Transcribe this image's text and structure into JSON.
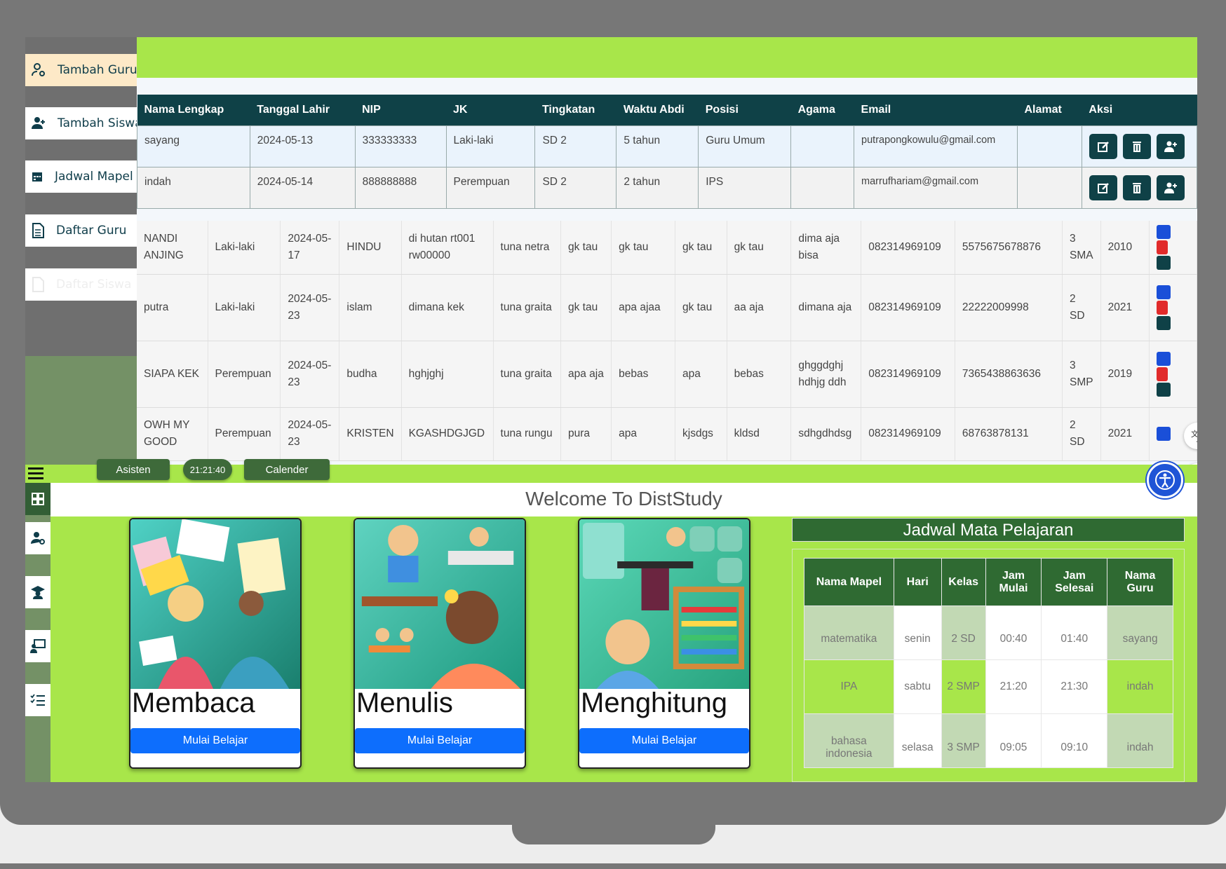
{
  "admin": {
    "sidebar": [
      {
        "label": "Tambah Guru",
        "icon": "user-gear-icon"
      },
      {
        "label": "Tambah Siswa",
        "icon": "user-plus-icon"
      },
      {
        "label": "Jadwal Mapel",
        "icon": "calendar-icon"
      },
      {
        "label": "Daftar Guru",
        "icon": "document-icon"
      },
      {
        "label": "Daftar Siswa",
        "icon": "document-icon"
      }
    ],
    "guru_table": {
      "headers": [
        "Nama Lengkap",
        "Tanggal Lahir",
        "NIP",
        "JK",
        "Tingkatan",
        "Waktu Abdi",
        "Posisi",
        "Agama",
        "Email",
        "Alamat",
        "Aksi"
      ],
      "rows": [
        [
          "sayang",
          "2024-05-13",
          "333333333",
          "Laki-laki",
          "SD 2",
          "5 tahun",
          "Guru Umum",
          "",
          "putrapongkowulu@gmail.com",
          ""
        ],
        [
          "indah",
          "2024-05-14",
          "888888888",
          "Perempuan",
          "SD 2",
          "2 tahun",
          "IPS",
          "",
          "marrufhariam@gmail.com",
          ""
        ]
      ]
    },
    "siswa_table": {
      "rows": [
        [
          "NANDI ANJING",
          "Laki-laki",
          "2024-05-17",
          "HINDU",
          "di hutan rt001 rw00000",
          "tuna netra",
          "gk tau",
          "gk tau",
          "gk tau",
          "gk tau",
          "dima aja bisa",
          "082314969109",
          "5575675678876",
          "3 SMA",
          "2010"
        ],
        [
          "putra",
          "Laki-laki",
          "2024-05-23",
          "islam",
          "dimana kek",
          "tuna graita",
          "gk tau",
          "apa ajaa",
          "gk tau",
          "aa aja",
          "dimana aja",
          "082314969109",
          "22222009998",
          "2 SD",
          "2021"
        ],
        [
          "SIAPA KEK",
          "Perempuan",
          "2024-05-23",
          "budha",
          "hghjghj",
          "tuna graita",
          "apa aja",
          "bebas",
          "apa",
          "bebas",
          "ghggdghj hdhjg ddh",
          "082314969109",
          "7365438863636",
          "3 SMP",
          "2019"
        ],
        [
          "OWH MY GOOD",
          "Perempuan",
          "2024-05-23",
          "KRISTEN",
          "KGASHDGJGD",
          "tuna rungu",
          "pura",
          "apa",
          "kjsdgs",
          "kldsd",
          "sdhgdhdsg",
          "082314969109",
          "68763878131",
          "2 SD",
          "2021"
        ]
      ]
    }
  },
  "student": {
    "topbar": {
      "asisten": "Asisten",
      "clock": "21:21:40",
      "calender": "Calender"
    },
    "welcome": "Welcome To DistStudy",
    "cards": [
      {
        "title": "Membaca",
        "button": "Mulai Belajar"
      },
      {
        "title": "Menulis",
        "button": "Mulai Belajar"
      },
      {
        "title": "Menghitung",
        "button": "Mulai Belajar"
      }
    ],
    "jadwal": {
      "title": "Jadwal Mata Pelajaran",
      "headers": [
        "Nama Mapel",
        "Hari",
        "Kelas",
        "Jam Mulai",
        "Jam Selesai",
        "Nama Guru"
      ],
      "rows": [
        [
          "matematika",
          "senin",
          "2 SD",
          "00:40",
          "01:40",
          "sayang"
        ],
        [
          "IPA",
          "sabtu",
          "2 SMP",
          "21:20",
          "21:30",
          "indah"
        ],
        [
          "bahasa indonesia",
          "selasa",
          "3 SMP",
          "09:05",
          "09:10",
          "indah"
        ]
      ]
    }
  },
  "colors": {
    "lime": "#a8e64a",
    "dark_teal": "#0f4147",
    "dark_green": "#2f6a32",
    "primary_blue": "#0d6efd"
  }
}
